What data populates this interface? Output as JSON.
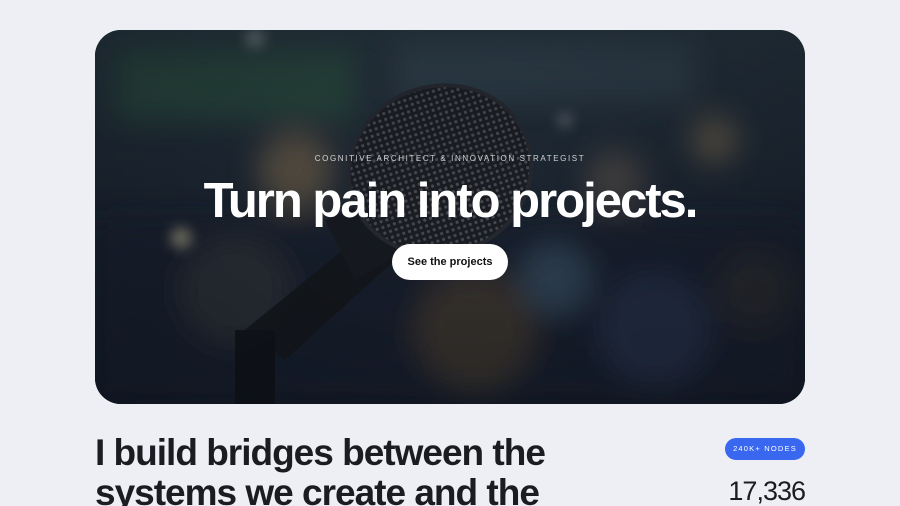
{
  "hero": {
    "eyebrow": "COGNITIVE ARCHITECT & INNOVATION STRATEGIST",
    "title": "Turn pain into projects.",
    "cta_label": "See the projects"
  },
  "intro": {
    "statement": "I build bridges between the systems we create and the"
  },
  "stats": {
    "badge": "240K+ NODES",
    "count": "17,336"
  },
  "colors": {
    "page_bg": "#eeeff4",
    "accent": "#3a67ef",
    "hero_text": "#ffffff"
  }
}
